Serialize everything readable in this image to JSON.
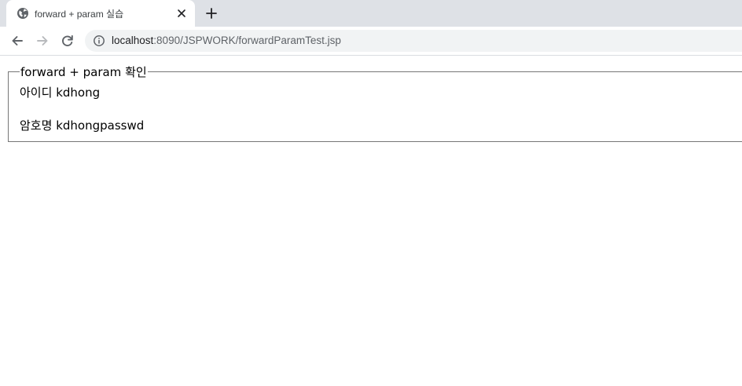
{
  "browser": {
    "tab": {
      "title": "forward + param 실습",
      "favicon": "globe-icon"
    },
    "address": {
      "host": "localhost",
      "rest": ":8090/JSPWORK/forwardParamTest.jsp"
    },
    "colors": {
      "tabstrip": "#dee1e6",
      "omnibox": "#f1f3f4"
    }
  },
  "page": {
    "legend": "forward + param 확인",
    "fields": [
      {
        "label": "아이디",
        "value": "kdhong"
      },
      {
        "label": "암호명",
        "value": "kdhongpasswd"
      }
    ]
  }
}
